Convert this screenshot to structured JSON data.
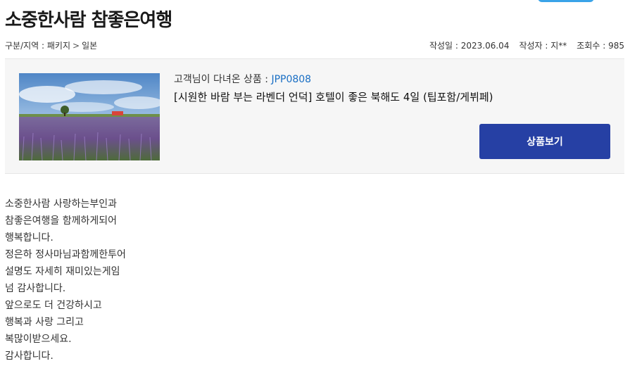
{
  "post": {
    "title": "소중한사람 참좋은여행"
  },
  "breadcrumb": {
    "category_label": "구분/지역 : 패키지",
    "separator": ">",
    "region": "일본"
  },
  "post_info": {
    "date": "작성일 : 2023.06.04",
    "author": "작성자 : 지**",
    "views": "조회수 : 985"
  },
  "product": {
    "code_label": "고객님이 다녀온 상품 : ",
    "code": "JPP0808",
    "name": "[시원한 바람 부는 라벤더 언덕] 호텔이 좋은 북해도 4일 (팁포함/게뷔페)",
    "button_label": "상품보기"
  },
  "review": {
    "lines": [
      "소중한사람 사랑하는부인과",
      "참좋은여행을 함께하게되어",
      "행복합니다.",
      "정은하 정사마님과함께한투어",
      "설명도 자세히 재미있는게임",
      "넘 감사합니다.",
      "앞으로도 더 건강하시고",
      "행복과 사랑 그리고",
      "복많이받으세요.",
      "감사합니다."
    ]
  },
  "colors": {
    "accent_blue": "#2640a4",
    "code_blue": "#1a6fc4"
  }
}
